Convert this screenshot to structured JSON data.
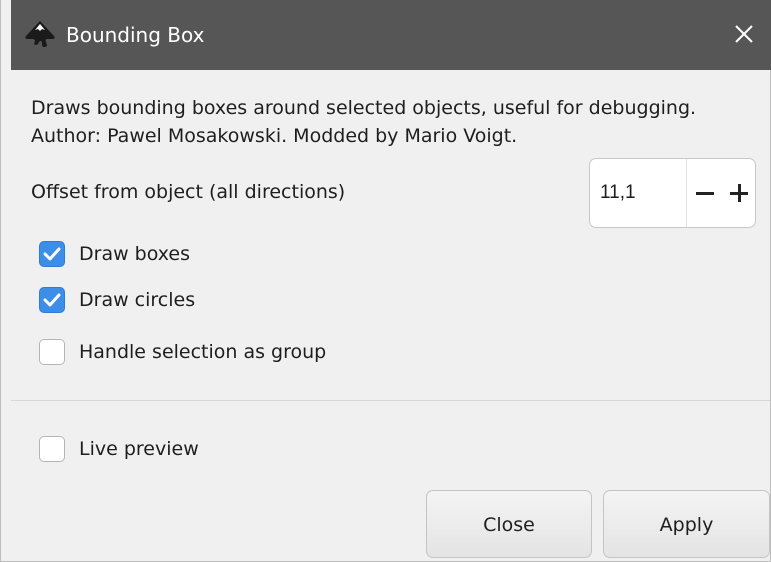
{
  "window": {
    "title": "Bounding Box",
    "app_icon": "inkscape-icon",
    "close_icon": "close-icon"
  },
  "description": "Draws bounding boxes around selected objects, useful for debugging. Author: Pawel Mosakowski. Modded by Mario Voigt.",
  "offset": {
    "label": "Offset from object (all directions)",
    "value": "11,1",
    "decrement_icon": "minus-icon",
    "increment_icon": "plus-icon"
  },
  "options": [
    {
      "label": "Draw boxes",
      "checked": true
    },
    {
      "label": "Draw circles",
      "checked": true
    },
    {
      "label": "Handle selection as group",
      "checked": false
    }
  ],
  "live_preview": {
    "label": "Live preview",
    "checked": false
  },
  "buttons": {
    "close_label": "Close",
    "apply_label": "Apply"
  },
  "colors": {
    "titlebar": "#565656",
    "checkbox_checked": "#3c8ee8",
    "background": "#f0f0f0"
  }
}
